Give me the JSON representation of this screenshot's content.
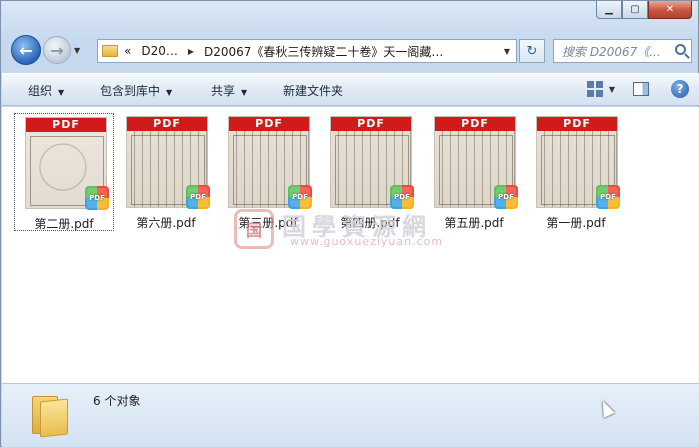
{
  "window": {
    "min_glyph": "▁",
    "max_glyph": "▢",
    "close_glyph": "✕"
  },
  "nav": {
    "back_glyph": "←",
    "forward_glyph": "→",
    "dropdown_glyph": "▼"
  },
  "address": {
    "chevrons": "«",
    "crumb1": "D20…",
    "crumb2": "D20067《春秋三传辨疑二十卷》天一阁藏…",
    "arrow": "▶",
    "dropdown": "▼"
  },
  "refresh_glyph": "↻",
  "search": {
    "placeholder": "搜索 D20067《..."
  },
  "toolbar": {
    "organize": "组织",
    "include_in_library": "包含到库中",
    "share": "共享",
    "new_folder": "新建文件夹",
    "dropdown_glyph": "▼",
    "help_glyph": "?"
  },
  "files": [
    {
      "name": "第二册.pdf",
      "badge": "PDF",
      "selected": true
    },
    {
      "name": "第六册.pdf",
      "badge": "PDF",
      "selected": false
    },
    {
      "name": "第三册.pdf",
      "badge": "PDF",
      "selected": false
    },
    {
      "name": "第四册.pdf",
      "badge": "PDF",
      "selected": false
    },
    {
      "name": "第五册.pdf",
      "badge": "PDF",
      "selected": false
    },
    {
      "name": "第一册.pdf",
      "badge": "PDF",
      "selected": false
    }
  ],
  "pdf_app_badge": "PDF",
  "watermark": {
    "seal": "国",
    "big": "国學資源網",
    "small": "www.guoxueziyuan.com"
  },
  "status": {
    "count_text": "6 个对象"
  },
  "colors": {
    "pdf_band": "#d11a1a",
    "toolbar_bg": "#dde8f4",
    "status_bg": "#d4e2f2"
  }
}
